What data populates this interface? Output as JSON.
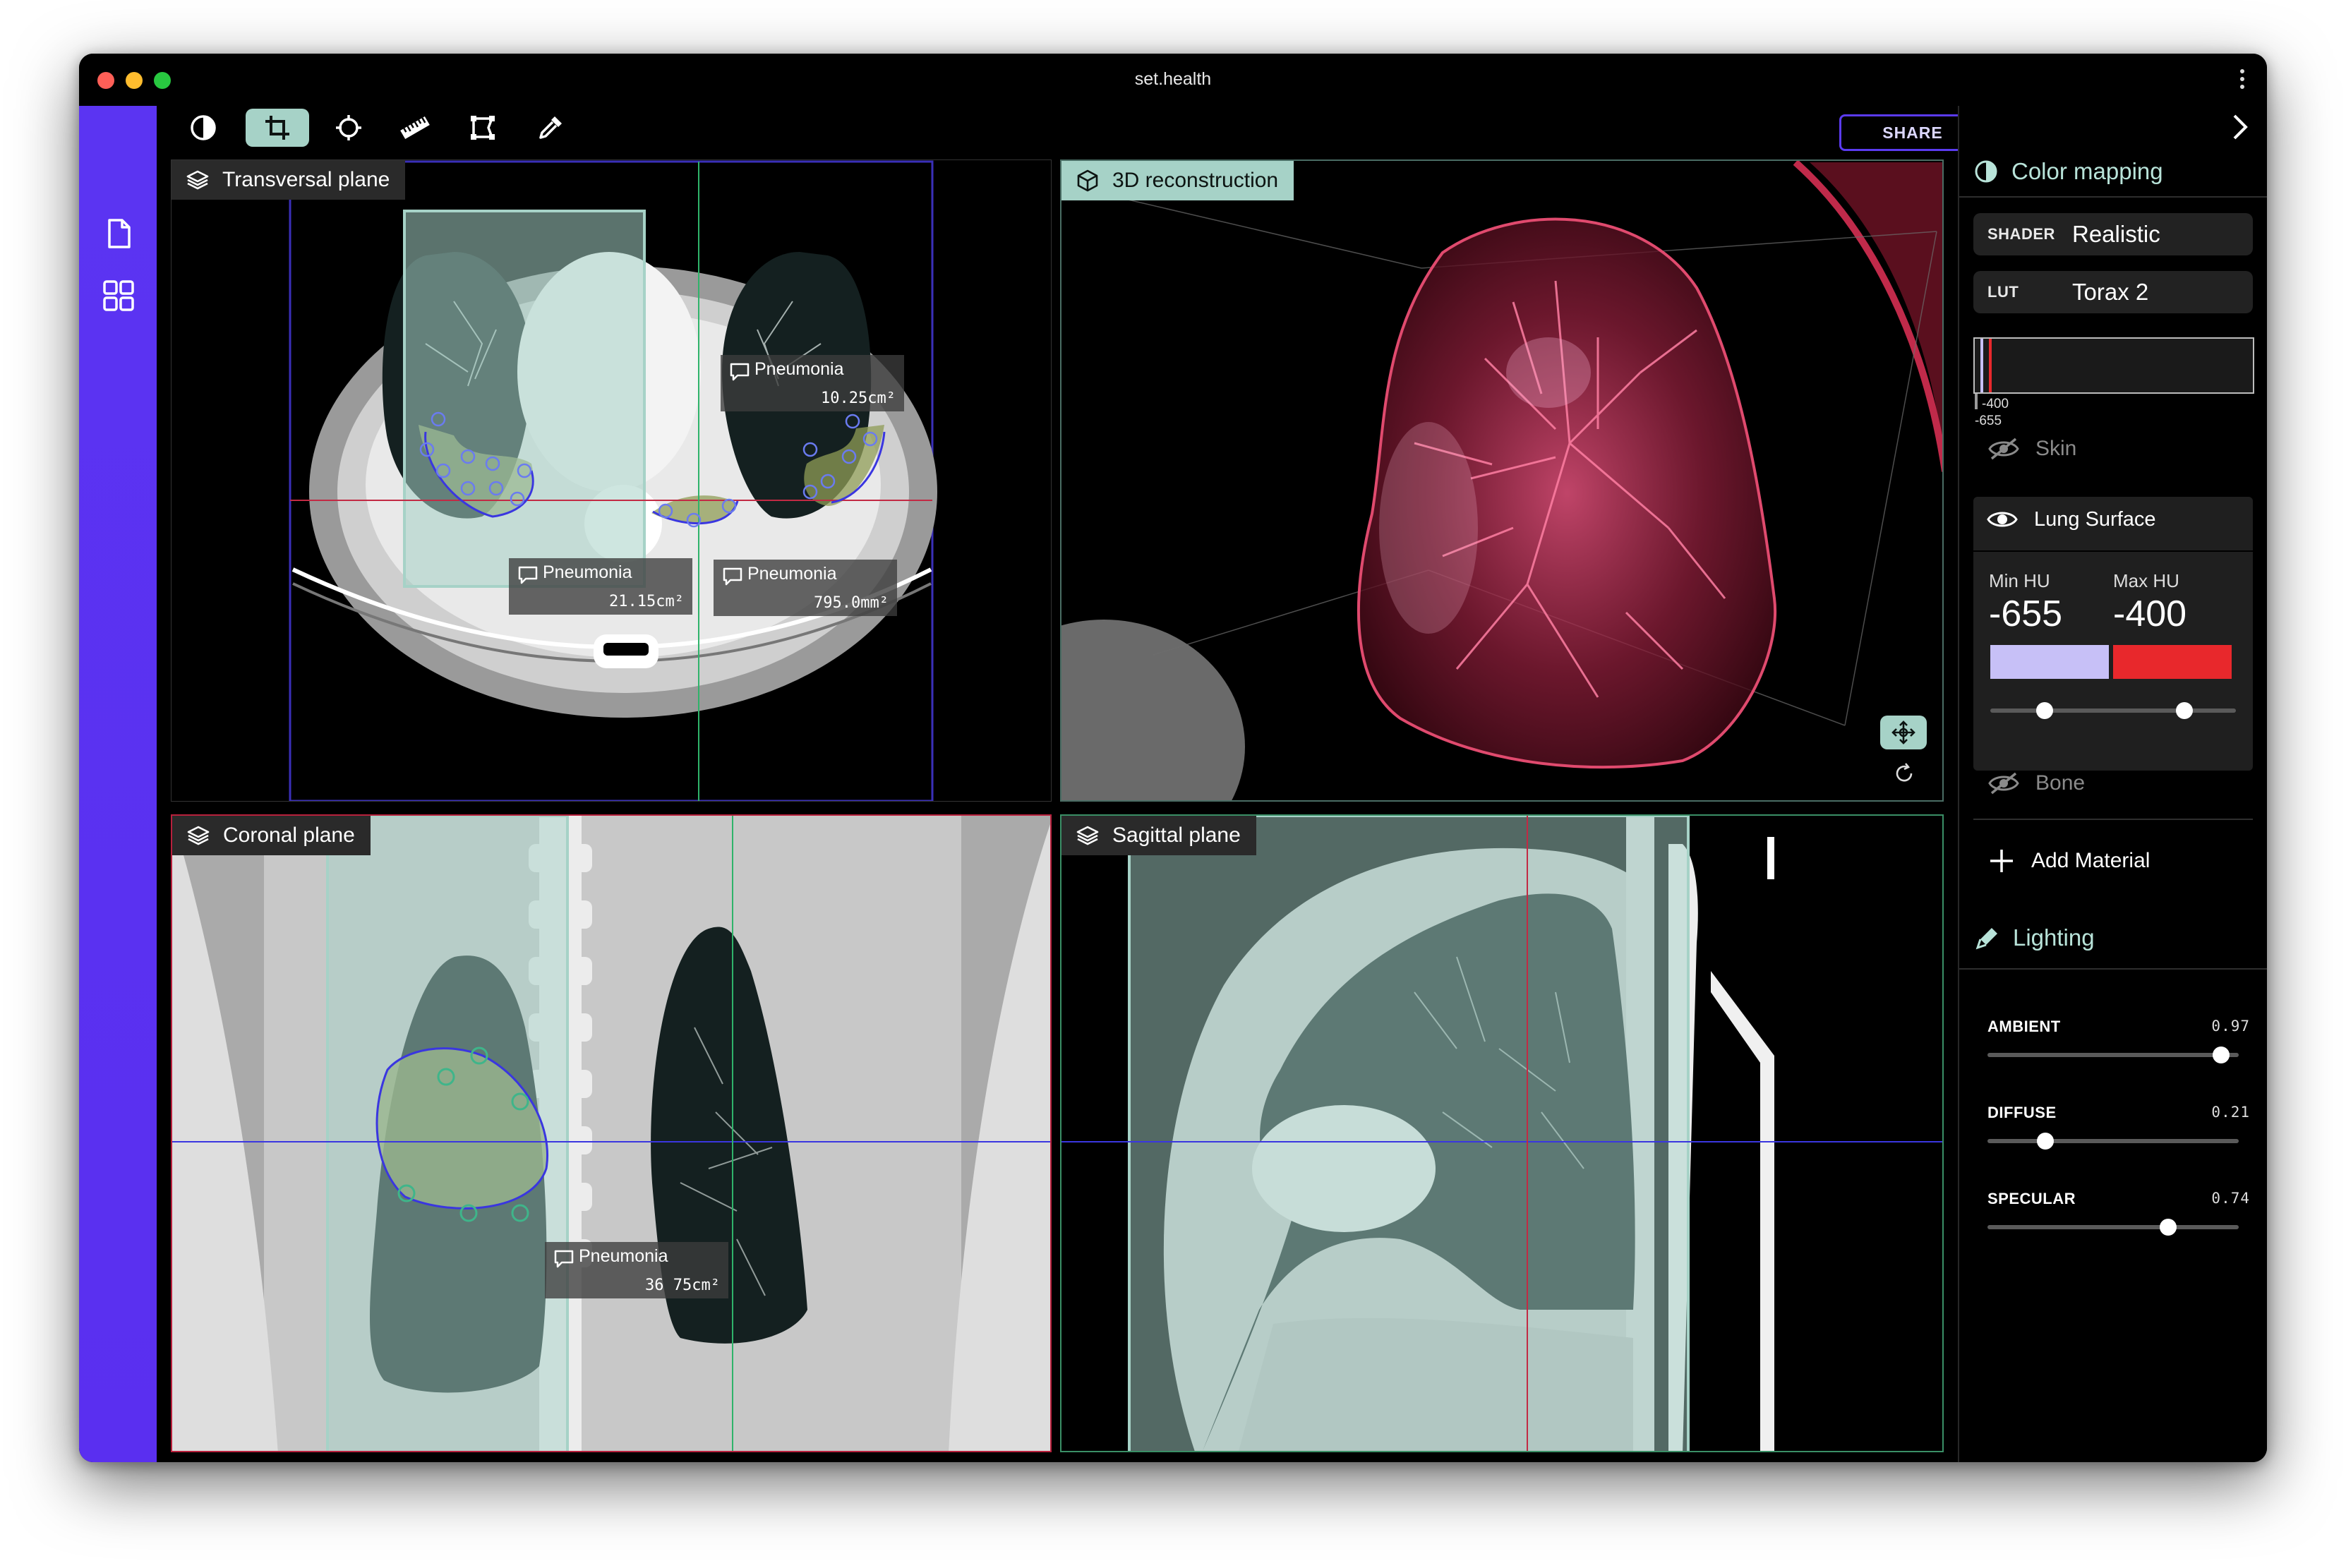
{
  "window": {
    "title": "set.health"
  },
  "traffic_lights": {
    "close": "#ff5f57",
    "minimize": "#febc2e",
    "zoom": "#28c840"
  },
  "colors": {
    "accent": "#5a2ff0",
    "mint": "#a6d2c7",
    "lut_low": "#c7c0f7",
    "lut_high": "#e8282c"
  },
  "sidebar": {
    "items": [
      {
        "icon": "document-icon"
      },
      {
        "icon": "grid-icon"
      }
    ]
  },
  "toolbar": {
    "tools": [
      {
        "icon": "contrast-icon"
      },
      {
        "icon": "crop-icon",
        "active": true
      },
      {
        "icon": "crosshair-icon"
      },
      {
        "icon": "ruler-icon"
      },
      {
        "icon": "shape-icon"
      },
      {
        "icon": "eyedropper-icon"
      }
    ],
    "share_label": "SHARE"
  },
  "viewports": {
    "transversal": {
      "label": "Transversal plane"
    },
    "reconstruction": {
      "label": "3D reconstruction"
    },
    "coronal": {
      "label": "Coronal plane"
    },
    "sagittal": {
      "label": "Sagittal plane"
    }
  },
  "annotations": {
    "t1": {
      "label": "Pneumonia",
      "measure": "10.25cm²"
    },
    "t2": {
      "label": "Pneumonia",
      "measure": "21.15cm²"
    },
    "t3": {
      "label": "Pneumonia",
      "measure": "795.0mm²"
    },
    "c1": {
      "label": "Pneumonia",
      "measure": "36 75cm²"
    }
  },
  "right_panel": {
    "color_mapping": {
      "title": "Color mapping"
    },
    "shader": {
      "key": "SHADER",
      "value": "Realistic"
    },
    "lut": {
      "key": "LUT",
      "value": "Torax 2"
    },
    "lut_bar": {
      "marker_top": "-400",
      "marker_bottom": "-655"
    },
    "materials": [
      {
        "name": "Skin",
        "visible": false
      },
      {
        "name": "Lung Surface",
        "visible": true
      },
      {
        "name": "Bone",
        "visible": false
      }
    ],
    "lung_surface": {
      "min_label": "Min HU",
      "min_value": "-655",
      "max_label": "Max HU",
      "max_value": "-400"
    },
    "add_material": "Add Material",
    "lighting": {
      "title": "Lighting",
      "ambient": {
        "label": "AMBIENT",
        "value": "0.97"
      },
      "diffuse": {
        "label": "DIFFUSE",
        "value": "0.21"
      },
      "specular": {
        "label": "SPECULAR",
        "value": "0.74"
      }
    }
  }
}
